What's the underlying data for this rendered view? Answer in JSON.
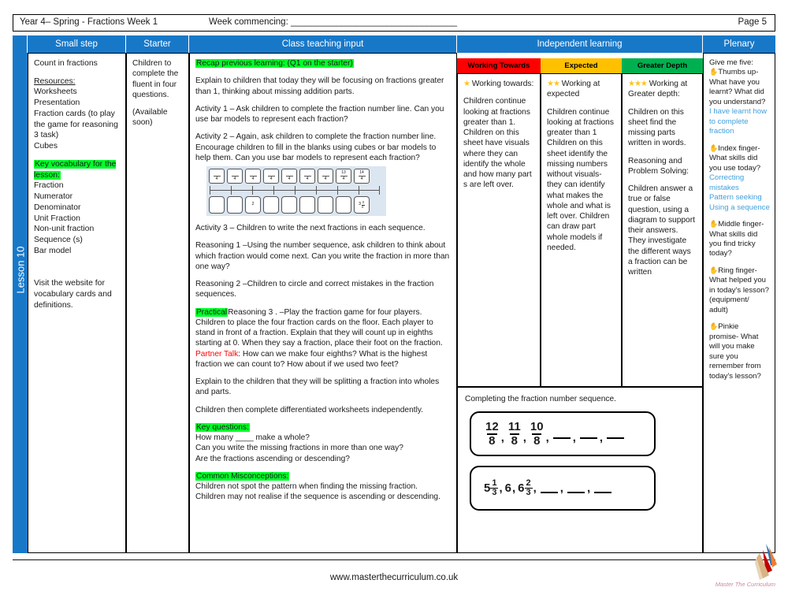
{
  "header": {
    "title": "Year 4– Spring - Fractions Week 1",
    "week_commencing": "Week commencing: _________________________________",
    "page": "Page 5"
  },
  "spine": {
    "lesson_label": "Lesson 10"
  },
  "columns": {
    "small_step": "Small step",
    "starter": "Starter",
    "class_teaching_input": "Class teaching input",
    "independent_learning": "Independent learning",
    "plenary": "Plenary"
  },
  "levels": {
    "working_towards": {
      "header": "Working Towards",
      "color": "#FF0000",
      "stars": "★",
      "title": "Working towards:"
    },
    "expected": {
      "header": "Expected",
      "color": "#FFC000",
      "stars": "★★",
      "title": "Working at expected"
    },
    "greater_depth": {
      "header": "Greater Depth",
      "color": "#00B050",
      "stars": "★★★",
      "title": "Working at Greater depth:"
    }
  },
  "small_step": {
    "objective": "Count in fractions",
    "resources_heading": "Resources:",
    "resources": "Worksheets\nPresentation\nFraction cards (to play the game for reasoning 3 task)\nCubes",
    "vocab_heading": "Key vocabulary for the lesson:",
    "vocab": "Fraction\nNumerator\nDenominator\nUnit Fraction\nNon-unit fraction\nSequence (s)\nBar model",
    "website_note": "Visit the website for vocabulary cards and definitions."
  },
  "starter": {
    "line1": "Children to complete the fluent in four questions.",
    "line2": "(Available soon)"
  },
  "teaching": {
    "recap": "Recap previous learning: (Q1 on the starter)",
    "intro": "Explain to children that today they will be focusing on fractions greater than 1, thinking about missing addition parts.",
    "activity1": "Activity 1 – Ask children to complete the fraction number line. Can you use bar models to represent each fraction?",
    "activity2": "Activity 2 – Again, ask children to complete the fraction number line. Encourage children to fill in the blanks using cubes or bar models to help them. Can you use bar models to represent each fraction?",
    "activity3": "Activity 3 – Children to write the next fractions in each sequence.",
    "reasoning1": "Reasoning 1 –Using the number sequence, ask children to think about which fraction would come next. Can you write the fraction in more than one way?",
    "reasoning2": "Reasoning 2 –Children to circle and correct mistakes in the fraction sequences.",
    "practical_tag": "Practical",
    "reasoning3": "Reasoning 3 . –Play the fraction game for four players. Children to place the four fraction cards on the floor. Each player to stand in front of a fraction. Explain that they will count up in eighths starting at 0. When they say a fraction, place their foot on the fraction. ",
    "partner_talk_tag": "Partner Talk",
    "partner_talk": ": How can we make four eighths? What is the highest fraction we can count to? How about if we used two feet?",
    "splitting": "Explain to the children that they will be splitting a fraction into wholes and parts.",
    "worksheets": "Children then complete differentiated worksheets independently.",
    "key_questions_heading": "Key questions:",
    "key_questions": "How many ____ make a whole?\nCan you write the missing fractions in more than one way?\nAre the fractions ascending or descending?",
    "misconceptions_heading": "Common Misconceptions:",
    "misconceptions": "Children not spot the pattern when finding the missing fraction.\nChildren may not realise if the sequence is ascending or descending."
  },
  "numberline": {
    "top_cards": [
      "",
      "",
      "",
      "",
      "",
      "",
      "",
      "13",
      "14"
    ],
    "denominator": "4",
    "bottom_cards": [
      "",
      "",
      "2",
      "",
      "",
      "",
      "",
      "",
      "3¾"
    ],
    "bottom_mixed_whole": "3",
    "bottom_mixed_num": "3",
    "bottom_mixed_den": "4"
  },
  "independent": {
    "working_towards_body": "Children continue looking at fractions greater than 1. Children on this sheet have visuals where they can identify the whole and how many part s are left over.",
    "expected_body": "Children continue looking at fractions greater than 1 Children on this sheet identify the missing numbers without visuals- they can identify what makes the whole and what is left over. Children can draw part whole models if needed.",
    "greater_depth_body1": "Children on this sheet find the missing parts written in words.",
    "greater_depth_body2": "Reasoning and Problem Solving:",
    "greater_depth_body3": "Children answer a true or false question, using a diagram to support their answers. They investigate the different ways a fraction can be written"
  },
  "worksheet": {
    "title": "Completing the fraction number sequence.",
    "sequence1": {
      "terms": [
        {
          "type": "fraction",
          "n": "12",
          "d": "8"
        },
        {
          "type": "fraction",
          "n": "11",
          "d": "8"
        },
        {
          "type": "fraction",
          "n": "10",
          "d": "8"
        },
        {
          "type": "blank"
        },
        {
          "type": "blank"
        },
        {
          "type": "blank"
        }
      ]
    },
    "sequence2": {
      "terms": [
        {
          "type": "mixed",
          "w": "5",
          "n": "1",
          "d": "3"
        },
        {
          "type": "whole",
          "w": "6"
        },
        {
          "type": "mixed",
          "w": "6",
          "n": "2",
          "d": "3"
        },
        {
          "type": "blank"
        },
        {
          "type": "blank"
        },
        {
          "type": "blank"
        }
      ]
    }
  },
  "plenary": {
    "intro": "Give me five:",
    "items": [
      {
        "icon": "hand-icon",
        "prompt": "Thumbs up- What have you learnt? What did you understand?",
        "answer": "I have learnt how to complete fraction"
      },
      {
        "icon": "hand-icon",
        "prompt": "Index finger- What skills did you use today?",
        "answer": "Correcting mistakes\nPattern seeking\nUsing a sequence"
      },
      {
        "icon": "hand-icon",
        "prompt": "Middle finger- What skills did you find tricky today?",
        "answer": ""
      },
      {
        "icon": "hand-icon",
        "prompt": "Ring finger- What helped you in today's lesson? (equipment/ adult)",
        "answer": ""
      },
      {
        "icon": "hand-icon",
        "prompt": "Pinkie promise- What will you make sure you remember from today's lesson?",
        "answer": ""
      }
    ]
  },
  "footer": {
    "url": "www.masterthecurriculum.co.uk",
    "logo_text": "Master The Curriculum"
  }
}
